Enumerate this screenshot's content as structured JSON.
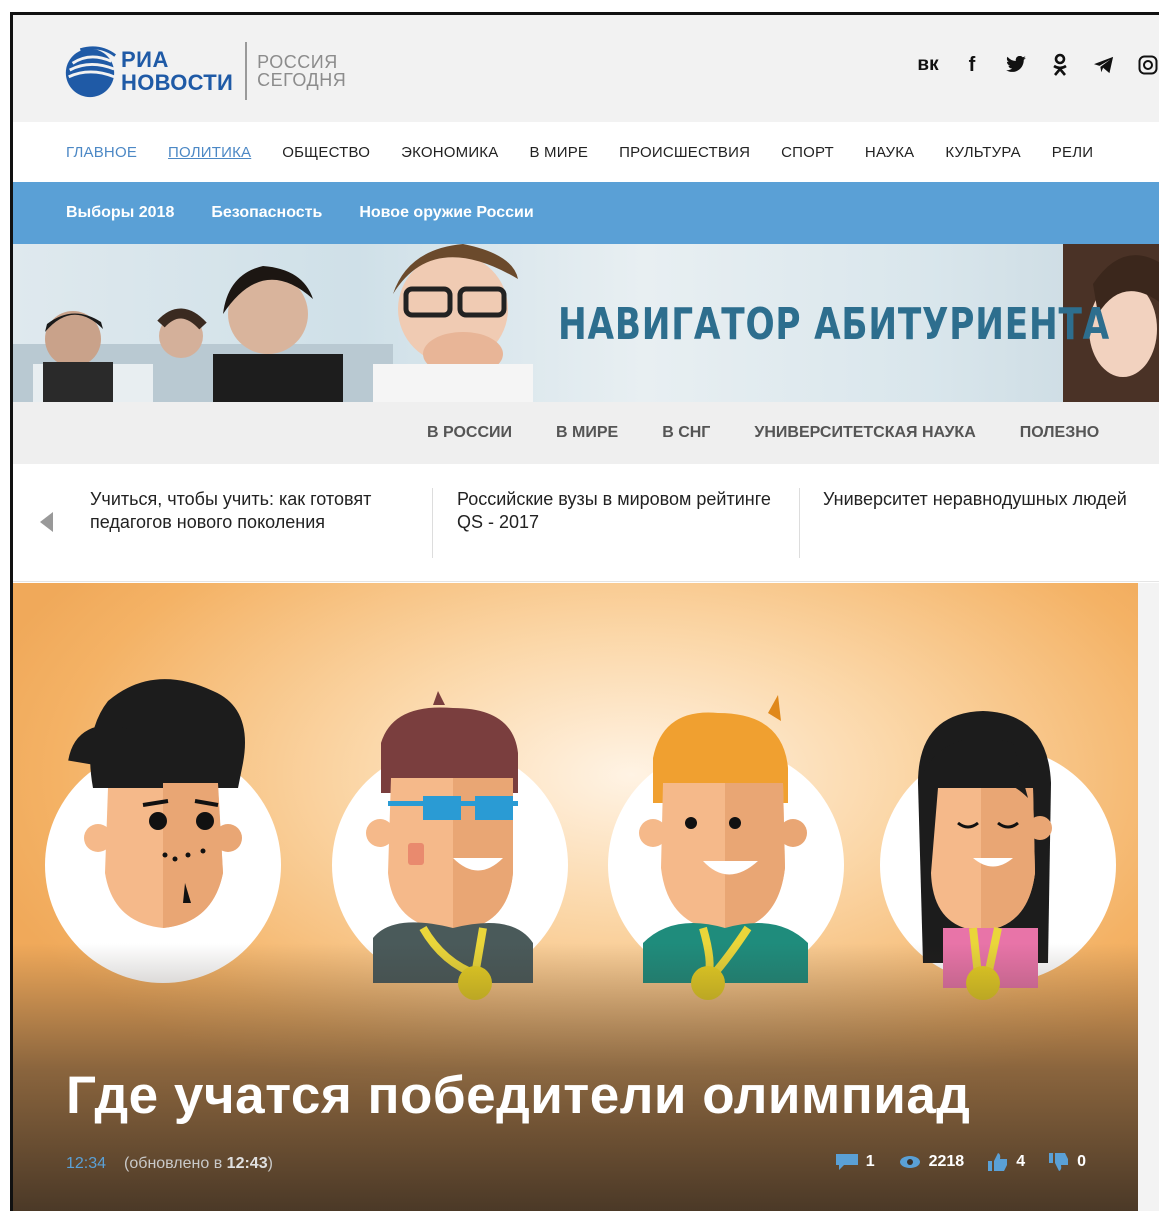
{
  "header": {
    "logo": {
      "line1": "РИА",
      "line2": "НОВОСТИ",
      "partner_line1": "РОССИЯ",
      "partner_line2": "СЕГОДНЯ"
    },
    "socials": [
      {
        "name": "vk-icon",
        "glyph": "к"
      },
      {
        "name": "facebook-icon",
        "glyph": "f"
      },
      {
        "name": "twitter-icon",
        "glyph": "❧"
      },
      {
        "name": "odnoklassniki-icon",
        "glyph": "♀"
      },
      {
        "name": "telegram-icon",
        "glyph": "➤"
      },
      {
        "name": "instagram-icon",
        "glyph": "◎"
      }
    ]
  },
  "mainnav": {
    "items": [
      "ГЛАВНОЕ",
      "ПОЛИТИКА",
      "ОБЩЕСТВО",
      "ЭКОНОМИКА",
      "В МИРЕ",
      "ПРОИСШЕСТВИЯ",
      "СПОРТ",
      "НАУКА",
      "КУЛЬТУРА",
      "РЕЛИ"
    ]
  },
  "subnav": {
    "items": [
      "Выборы 2018",
      "Безопасность",
      "Новое оружие России"
    ]
  },
  "banner": {
    "title": "НАВИГАТОР АБИТУРИЕНТА"
  },
  "categories": {
    "items": [
      "В РОССИИ",
      "В МИРЕ",
      "В СНГ",
      "УНИВЕРСИТЕТСКАЯ НАУКА",
      "ПОЛЕЗНО"
    ]
  },
  "carousel": {
    "items": [
      "Учиться, чтобы учить: как готовят педагогов нового поколения",
      "Российские вузы в мировом рейтинге QS - 2017",
      "Университет неравнодушных людей"
    ]
  },
  "hero": {
    "title": "Где учатся победители олимпиад",
    "time": "12:34",
    "updated_prefix": "(обновлено в ",
    "updated_time": "12:43",
    "updated_suffix": ")",
    "stats": {
      "comments": "1",
      "views": "2218",
      "likes": "4",
      "dislikes": "0"
    }
  },
  "colors": {
    "accent": "#5aa0d6",
    "brand": "#1f5aa6",
    "banner_text": "#2d6e8e"
  }
}
